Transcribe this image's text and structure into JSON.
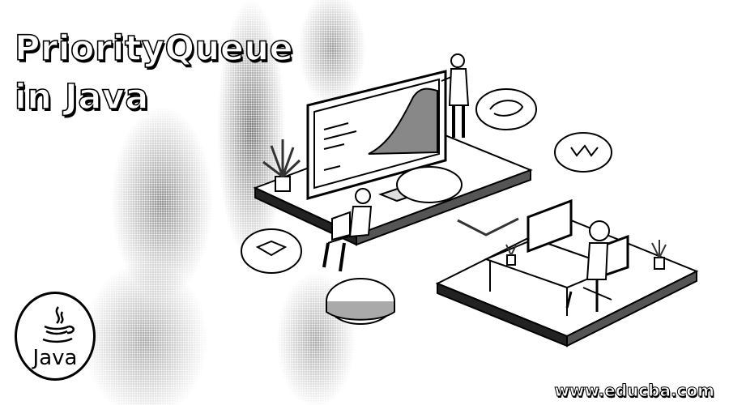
{
  "banner": {
    "title_line1": "PriorityQueue",
    "title_line2": "in Java",
    "logo_label": "Java",
    "website": "www.educba.com"
  },
  "icons": [
    "java-logo-icon",
    "desktop-monitor-icon",
    "person-icon",
    "plant-icon",
    "laptop-icon",
    "office-chair-icon"
  ]
}
